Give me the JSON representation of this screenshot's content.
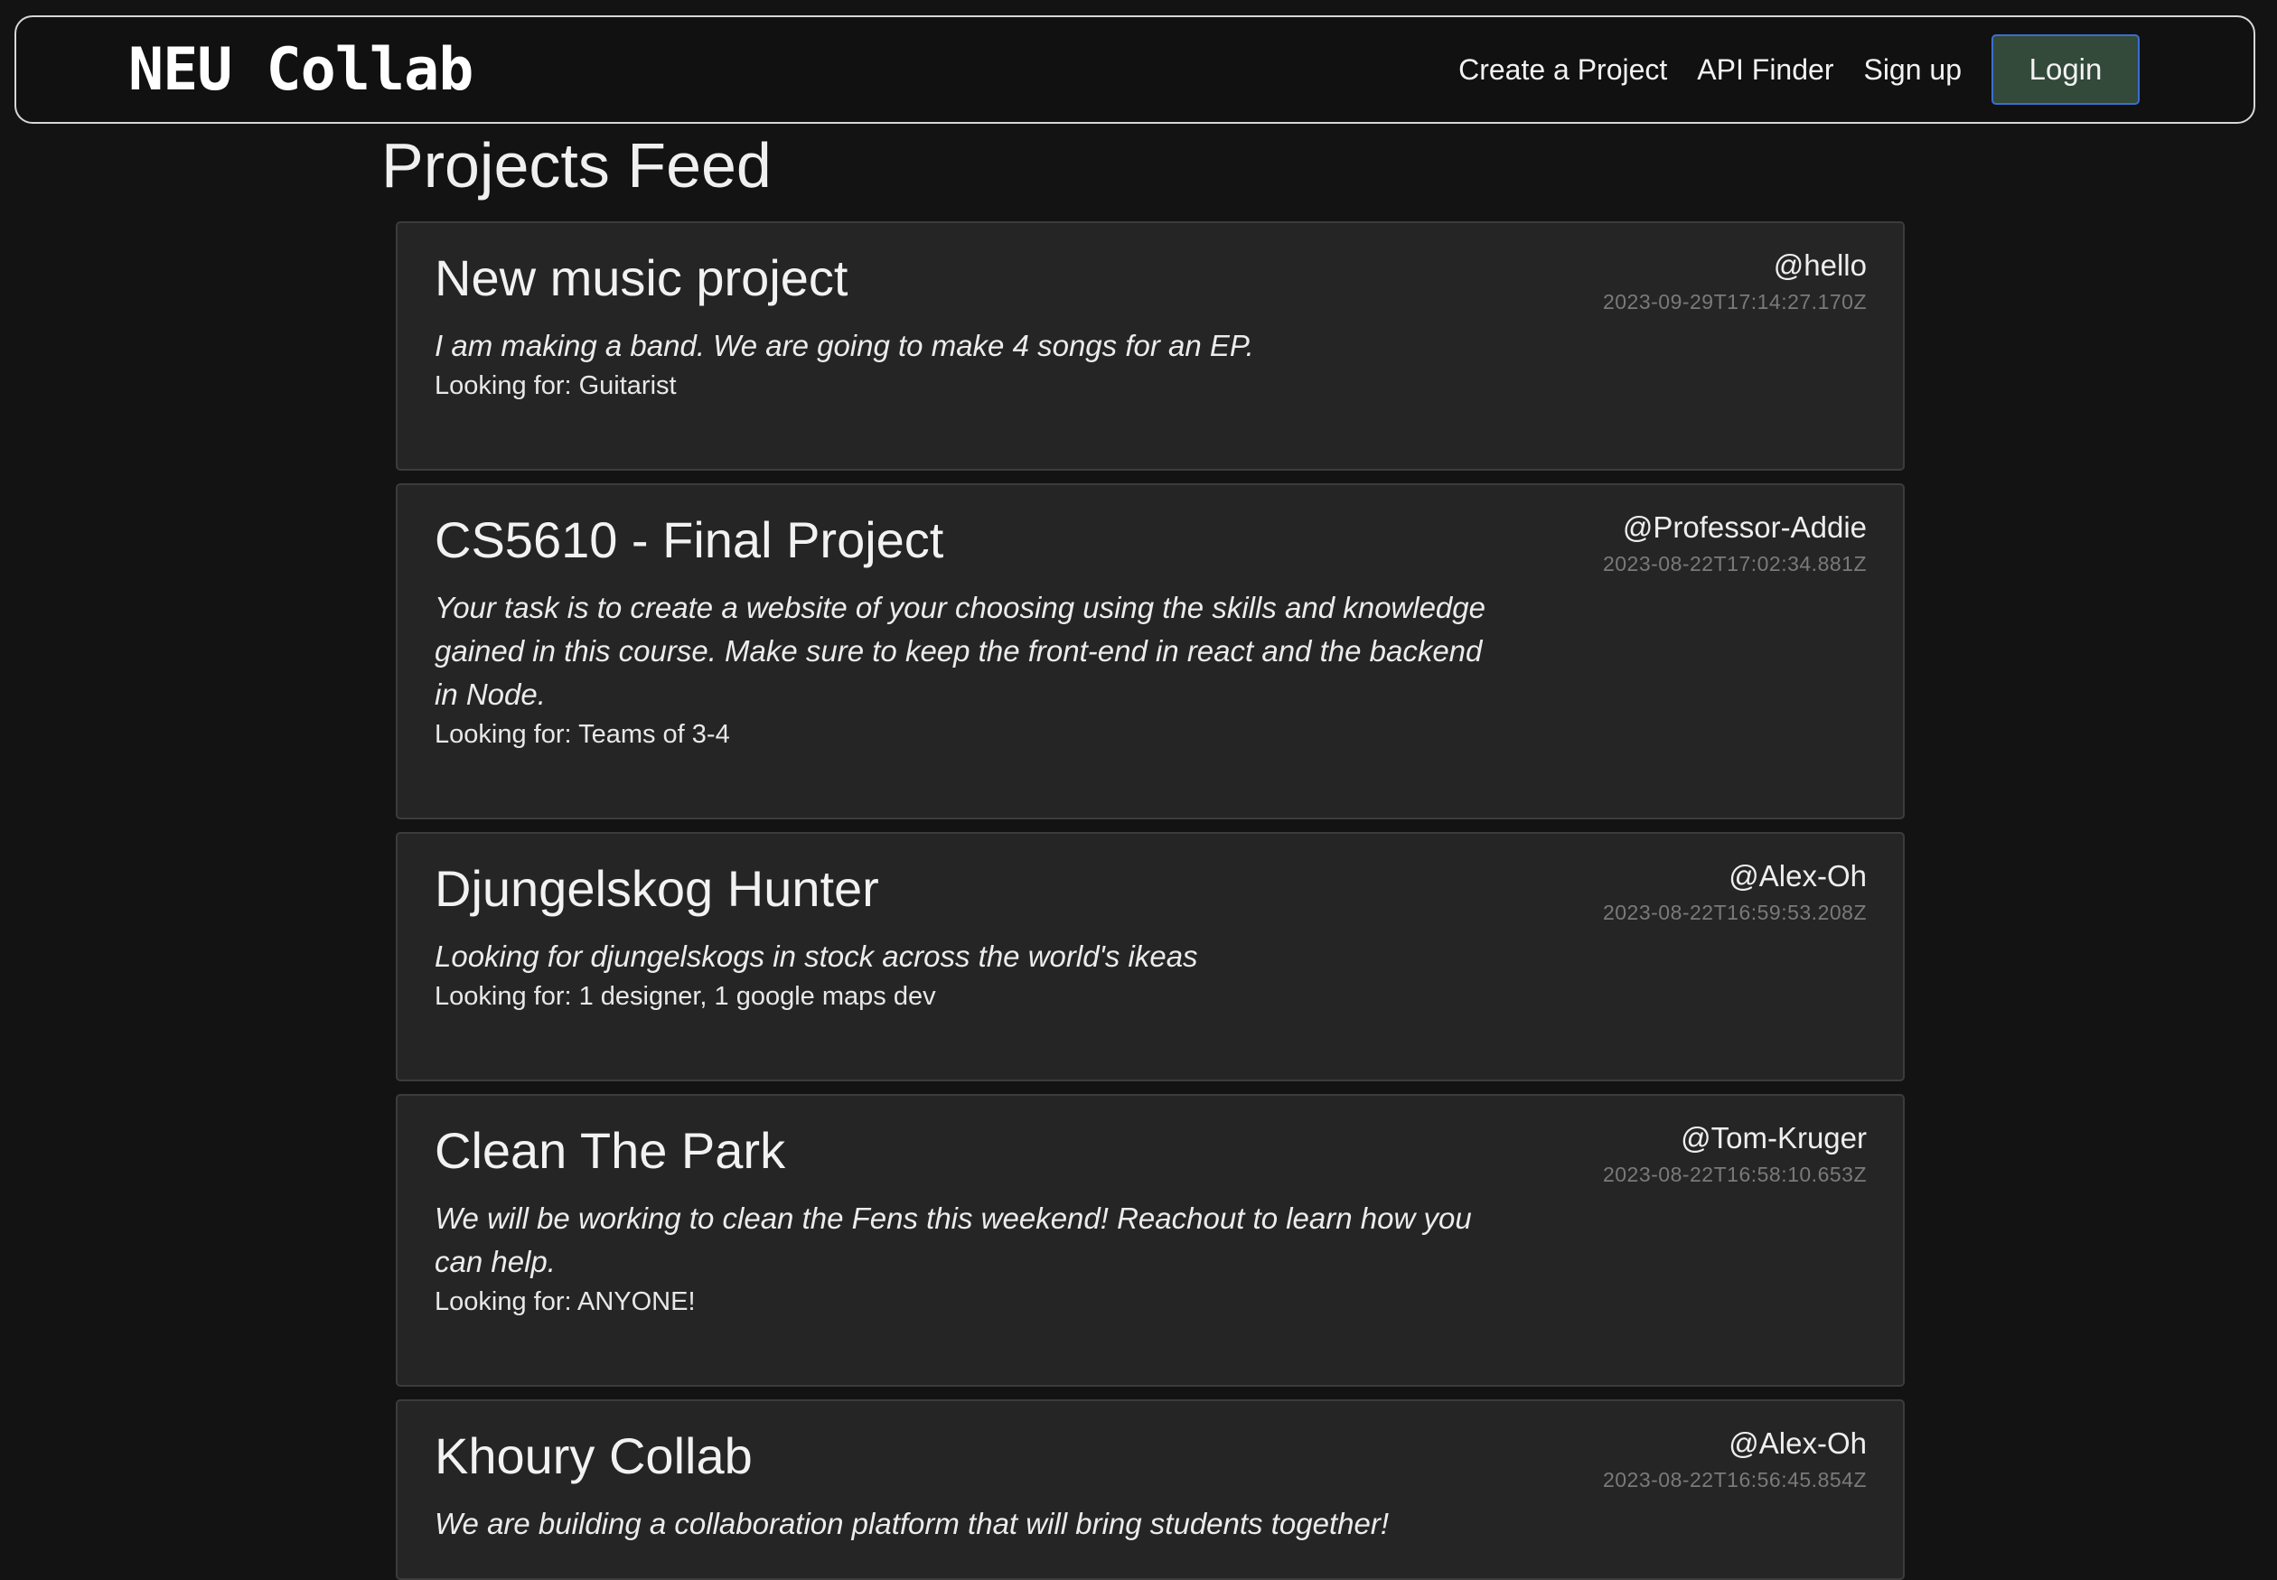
{
  "navbar": {
    "brand": "NEU Collab",
    "links": [
      "Create a Project",
      "API Finder",
      "Sign up"
    ],
    "login_label": "Login"
  },
  "feed": {
    "title": "Projects Feed",
    "projects": [
      {
        "title": "New music project",
        "author": "@hello",
        "date": "2023-09-29T17:14:27.170Z",
        "description": "I am making a band. We are going to make 4 songs for an EP.",
        "looking_for": "Looking for: Guitarist"
      },
      {
        "title": "CS5610 - Final Project",
        "author": "@Professor-Addie",
        "date": "2023-08-22T17:02:34.881Z",
        "description": "Your task is to create a website of your choosing using the skills and knowledge gained in this course. Make sure to keep the front-end in react and the backend in Node.",
        "looking_for": "Looking for: Teams of 3-4"
      },
      {
        "title": "Djungelskog Hunter",
        "author": "@Alex-Oh",
        "date": "2023-08-22T16:59:53.208Z",
        "description": "Looking for djungelskogs in stock across the world's ikeas",
        "looking_for": "Looking for: 1 designer, 1 google maps dev"
      },
      {
        "title": "Clean The Park",
        "author": "@Tom-Kruger",
        "date": "2023-08-22T16:58:10.653Z",
        "description": "We will be working to clean the Fens this weekend! Reachout to learn how you can help.",
        "looking_for": "Looking for: ANYONE!"
      },
      {
        "title": "Khoury Collab",
        "author": "@Alex-Oh",
        "date": "2023-08-22T16:56:45.854Z",
        "description": "We are building a collaboration platform that will bring students together!",
        "looking_for": ""
      }
    ]
  }
}
